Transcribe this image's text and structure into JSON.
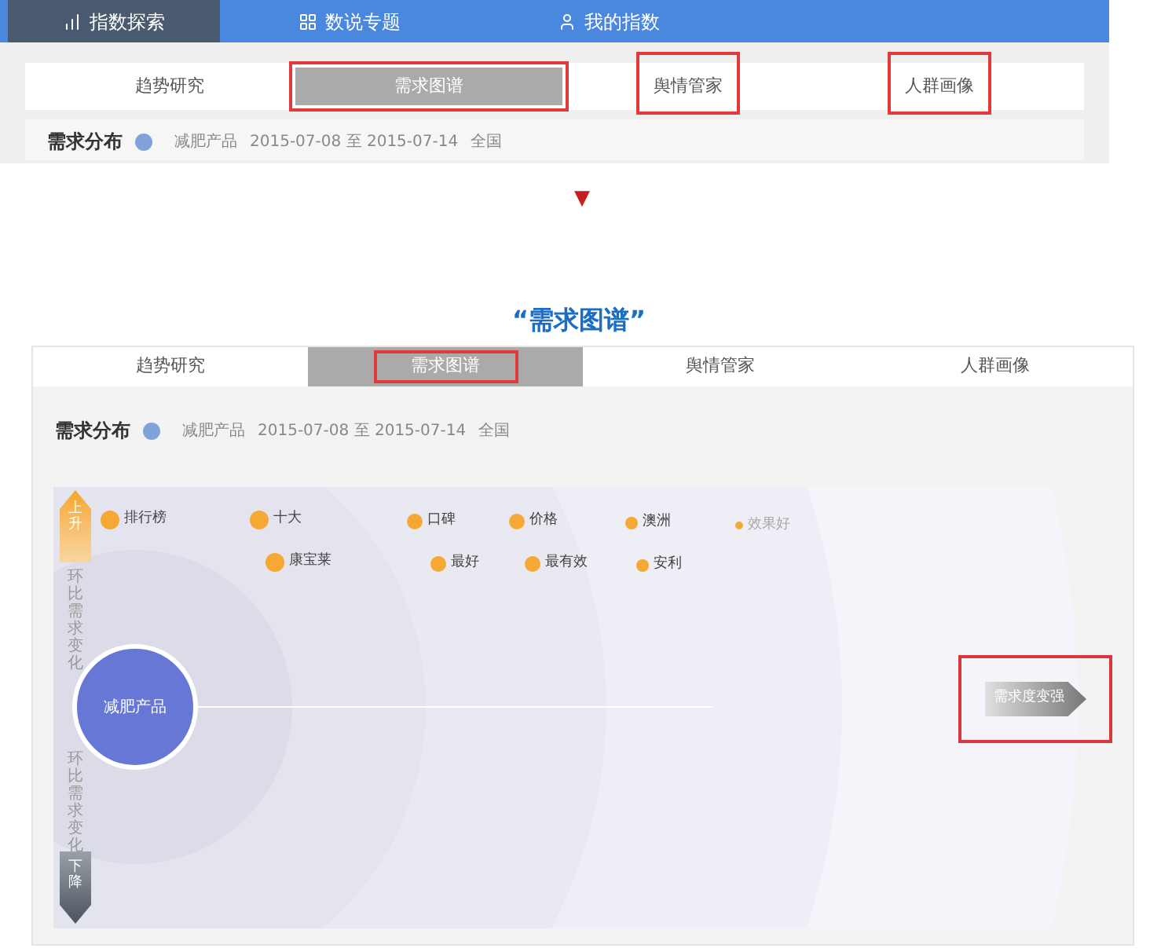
{
  "nav": {
    "items": [
      {
        "label": "指数探索",
        "selected": true
      },
      {
        "label": "数说专题",
        "selected": false
      },
      {
        "label": "我的指数",
        "selected": false
      }
    ]
  },
  "panel_before": {
    "tabs": [
      {
        "label": "趋势研究",
        "selected": false,
        "highlighted": false
      },
      {
        "label": "需求图谱",
        "selected": true,
        "highlighted": true
      },
      {
        "label": "舆情管家",
        "selected": false,
        "highlighted": true
      },
      {
        "label": "人群画像",
        "selected": false,
        "highlighted": true
      }
    ],
    "section_title": "需求分布",
    "keyword": "减肥产品",
    "date_range": "2015-07-08 至 2015-07-14",
    "region": "全国"
  },
  "divider_arrow": "▼",
  "caption": "“需求图谱”",
  "panel_after": {
    "tabs": [
      {
        "label": "趋势研究",
        "selected": false,
        "highlighted": false
      },
      {
        "label": "需求图谱",
        "selected": true,
        "highlighted": true
      },
      {
        "label": "舆情管家",
        "selected": false,
        "highlighted": false
      },
      {
        "label": "人群画像",
        "selected": false,
        "highlighted": false
      }
    ],
    "section_title": "需求分布",
    "keyword": "减肥产品",
    "date_range": "2015-07-08 至 2015-07-14",
    "region": "全国",
    "graph": {
      "up_label": "上升",
      "down_label": "下降",
      "axis_label_top": "环比需求变化",
      "axis_label_bottom": "环比需求变化",
      "center": "减肥产品",
      "strength_button": {
        "label": "需求度变强",
        "highlighted": true
      },
      "keywords": [
        {
          "label": "排行榜",
          "kind": "large"
        },
        {
          "label": "十大",
          "kind": "large"
        },
        {
          "label": "口碑",
          "kind": "medium"
        },
        {
          "label": "价格",
          "kind": "medium"
        },
        {
          "label": "澳洲",
          "kind": "small"
        },
        {
          "label": "效果好",
          "kind": "tiny"
        },
        {
          "label": "康宝莱",
          "kind": "large"
        },
        {
          "label": "最好",
          "kind": "medium"
        },
        {
          "label": "最有效",
          "kind": "medium"
        },
        {
          "label": "安利",
          "kind": "small"
        }
      ]
    }
  }
}
